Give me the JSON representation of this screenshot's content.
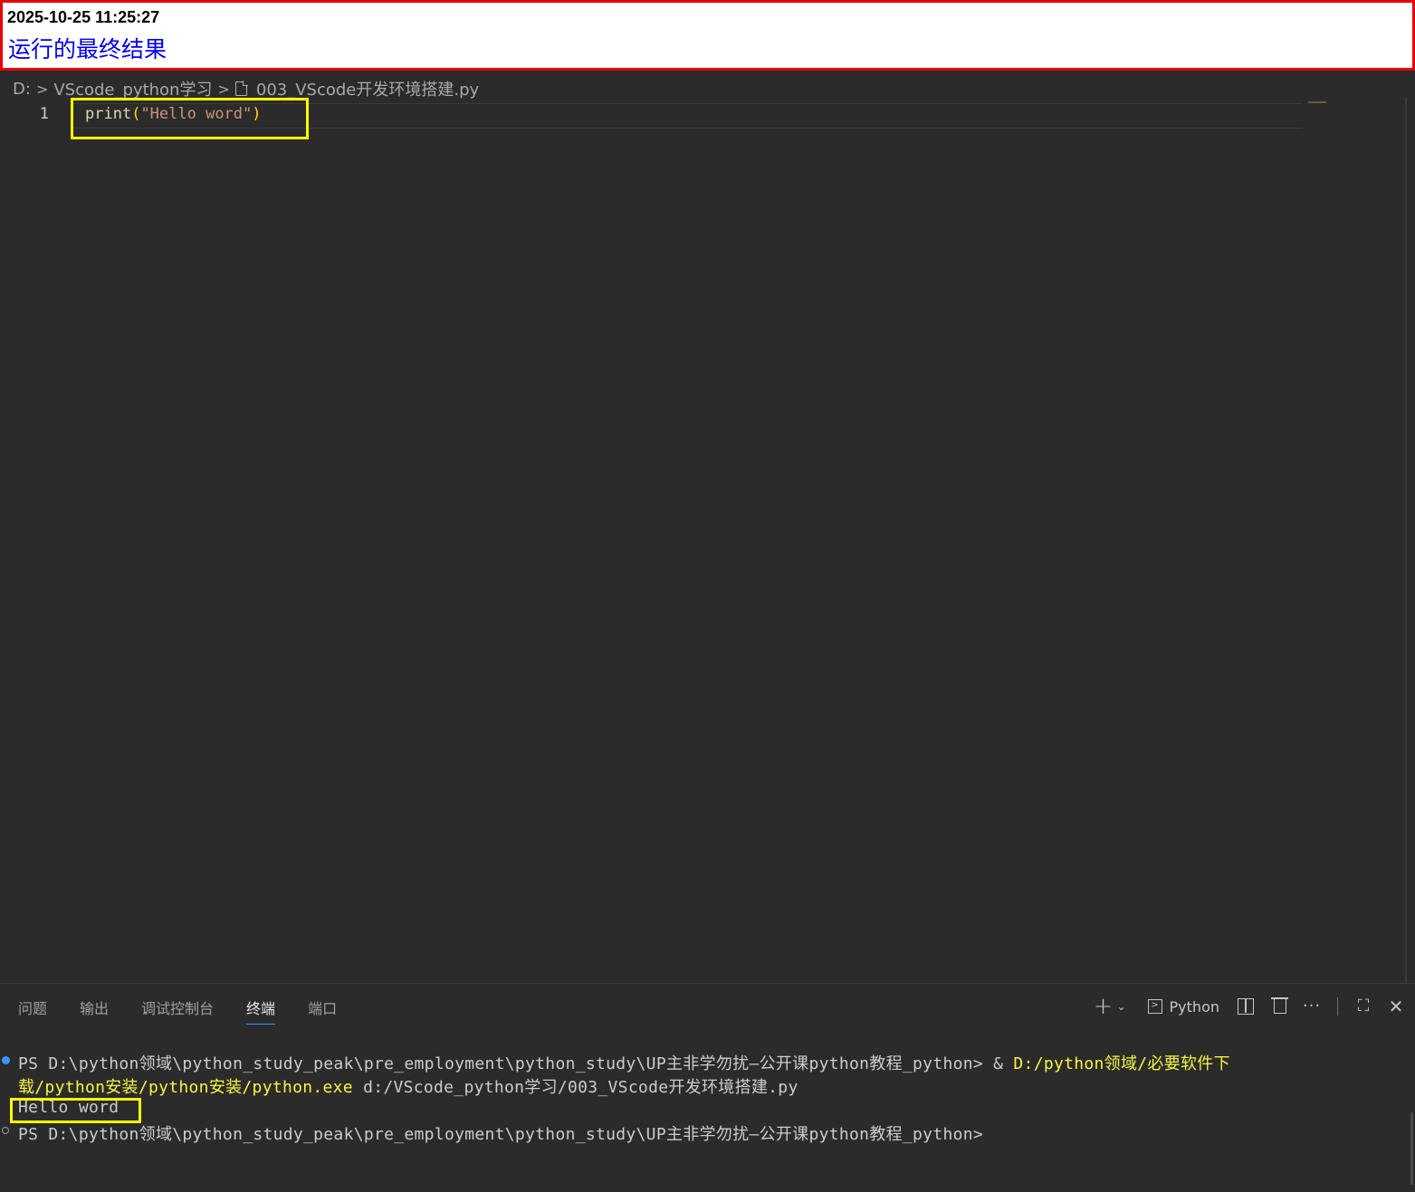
{
  "banner": {
    "timestamp": "2025-10-25 11:25:27",
    "caption": "运行的最终结果"
  },
  "breadcrumb": {
    "drive": "D:",
    "folder": "VScode_python学习",
    "file": "003_VScode开发环境搭建.py"
  },
  "editor": {
    "line_number": "1",
    "code": {
      "fn": "print",
      "open": "(",
      "str": "\"Hello word\"",
      "close": ")"
    }
  },
  "panel": {
    "tabs": [
      "问题",
      "输出",
      "调试控制台",
      "终端",
      "端口"
    ],
    "active_tab": "终端",
    "terminal_profile": "Python"
  },
  "terminal": {
    "line1_prompt": "PS D:\\python领域\\python_study_peak\\pre_employment\\python_study\\UP主非学勿扰—公开课python教程_python> & ",
    "line1_exe_a": "D:/python领域/必要软件下",
    "line2_exe_b": "载/python安装/python安装/python.exe",
    "line2_arg": " d:/VScode_python学习/003_VScode开发环境搭建.py",
    "output": "Hello word",
    "line4_prompt": "PS D:\\python领域\\python_study_peak\\pre_employment\\python_study\\UP主非学勿扰—公开课python教程_python>"
  },
  "colors": {
    "banner_border": "#e8000d",
    "caption_blue": "#0000ee",
    "highlight_yellow": "#ffff00",
    "editor_bg": "#2b2b2b",
    "string": "#ce9178",
    "function": "#dcdcaa",
    "terminal_yellow": "#f5f543",
    "accent_blue": "#3794ff"
  },
  "icons": [
    "file-icon",
    "chevron-right-icon",
    "plus-icon",
    "chevron-down-icon",
    "terminal-icon",
    "split-icon",
    "trash-icon",
    "more-icon",
    "maximize-icon",
    "close-icon"
  ]
}
